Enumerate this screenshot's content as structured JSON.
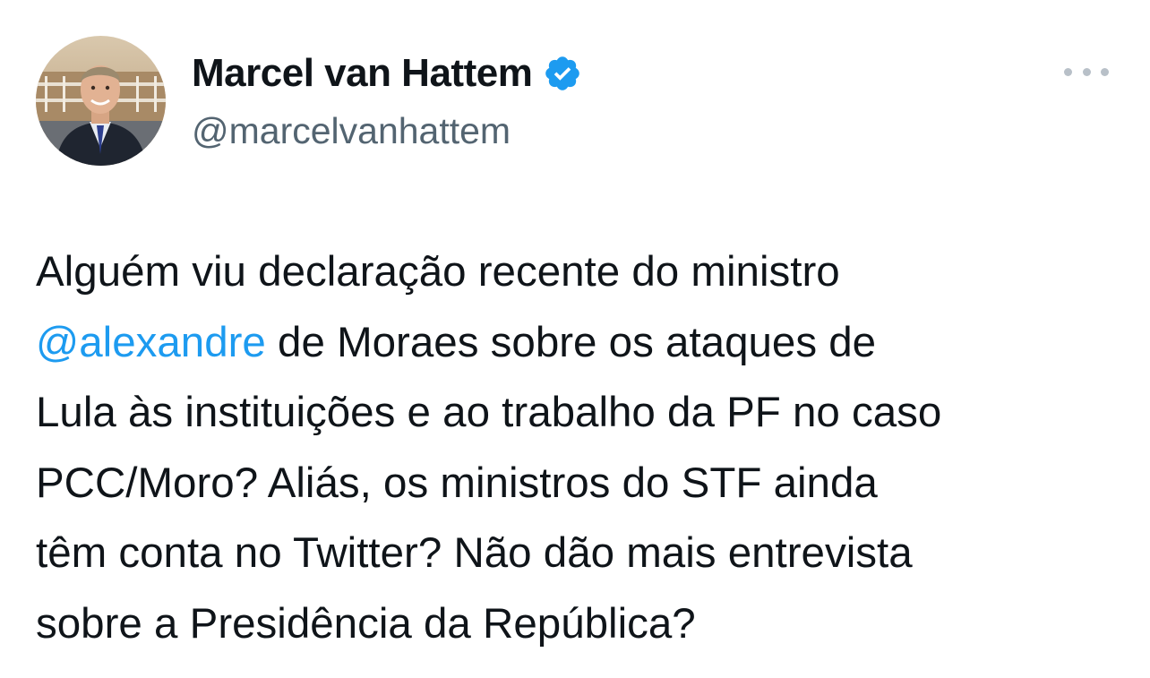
{
  "author": {
    "display_name": "Marcel van Hattem",
    "handle": "@marcelvanhattem",
    "verified": true,
    "verified_color": "#1d9bf0",
    "avatar_icon": "profile-photo"
  },
  "more_menu": {
    "icon": "more-horizontal-icon"
  },
  "tweet": {
    "lines": [
      {
        "text": "Alguém viu declaração recente do ministro"
      },
      {
        "mention": "@alexandre",
        "text": " de Moraes sobre os ataques de"
      },
      {
        "text": "Lula às instituições e ao trabalho da PF no caso"
      },
      {
        "text": "PCC/Moro? Aliás, os ministros do STF ainda"
      },
      {
        "text": "têm conta no Twitter? Não dão mais entrevista"
      },
      {
        "text": "sobre a Presidência da República?"
      }
    ],
    "mention_color": "#1d9bf0"
  }
}
